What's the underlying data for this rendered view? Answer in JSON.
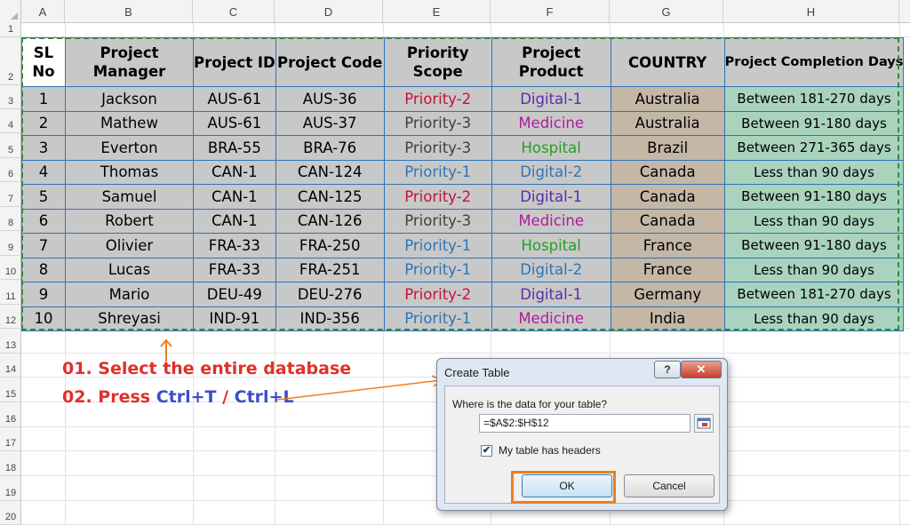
{
  "columns": [
    "A",
    "B",
    "C",
    "D",
    "E",
    "F",
    "G",
    "H"
  ],
  "rows": [
    "1",
    "2",
    "3",
    "4",
    "5",
    "6",
    "7",
    "8",
    "9",
    "10",
    "11",
    "12",
    "13",
    "14",
    "15",
    "16",
    "17",
    "18",
    "19",
    "20"
  ],
  "table": {
    "headers": {
      "sl": "SL No",
      "manager": "Project Manager",
      "id": "Project ID",
      "code": "Project Code",
      "priority": "Priority Scope",
      "product": "Project Product",
      "country": "COUNTRY",
      "days": "Project Completion Days"
    },
    "rows": [
      {
        "sl": "1",
        "manager": "Jackson",
        "id": "AUS-61",
        "code": "AUS-36",
        "priority": "Priority-2",
        "product": "Digital-1",
        "country": "Australia",
        "days": "Between 181-270 days"
      },
      {
        "sl": "2",
        "manager": "Mathew",
        "id": "AUS-61",
        "code": "AUS-37",
        "priority": "Priority-3",
        "product": "Medicine",
        "country": "Australia",
        "days": "Between 91-180 days"
      },
      {
        "sl": "3",
        "manager": "Everton",
        "id": "BRA-55",
        "code": "BRA-76",
        "priority": "Priority-3",
        "product": "Hospital",
        "country": "Brazil",
        "days": "Between 271-365 days"
      },
      {
        "sl": "4",
        "manager": "Thomas",
        "id": "CAN-1",
        "code": "CAN-124",
        "priority": "Priority-1",
        "product": "Digital-2",
        "country": "Canada",
        "days": "Less than 90 days"
      },
      {
        "sl": "5",
        "manager": "Samuel",
        "id": "CAN-1",
        "code": "CAN-125",
        "priority": "Priority-2",
        "product": "Digital-1",
        "country": "Canada",
        "days": "Between 91-180 days"
      },
      {
        "sl": "6",
        "manager": "Robert",
        "id": "CAN-1",
        "code": "CAN-126",
        "priority": "Priority-3",
        "product": "Medicine",
        "country": "Canada",
        "days": "Less than 90 days"
      },
      {
        "sl": "7",
        "manager": "Olivier",
        "id": "FRA-33",
        "code": "FRA-250",
        "priority": "Priority-1",
        "product": "Hospital",
        "country": "France",
        "days": "Between 91-180 days"
      },
      {
        "sl": "8",
        "manager": "Lucas",
        "id": "FRA-33",
        "code": "FRA-251",
        "priority": "Priority-1",
        "product": "Digital-2",
        "country": "France",
        "days": "Less than 90 days"
      },
      {
        "sl": "9",
        "manager": "Mario",
        "id": "DEU-49",
        "code": "DEU-276",
        "priority": "Priority-2",
        "product": "Digital-1",
        "country": "Germany",
        "days": "Between 181-270 days"
      },
      {
        "sl": "10",
        "manager": "Shreyasi",
        "id": "IND-91",
        "code": "IND-356",
        "priority": "Priority-1",
        "product": "Medicine",
        "country": "India",
        "days": "Less than 90 days"
      }
    ]
  },
  "colors": {
    "priority": {
      "Priority-1": "#2e75b6",
      "Priority-2": "#c0143c",
      "Priority-3": "#404040"
    },
    "product": {
      "Digital-1": "#5b2ca8",
      "Digital-2": "#2e75b6",
      "Medicine": "#b01aa0",
      "Hospital": "#22a022"
    },
    "annotation_red": "#e0302a",
    "annotation_blue": "#3b4fc4",
    "highlight_orange": "#f07d1e",
    "marquee_green": "#2e8b3d"
  },
  "annotations": {
    "step1": "01. Select the entire database",
    "step2_prefix": "02. Press ",
    "step2_key1": "Ctrl+T",
    "step2_sep": " / ",
    "step2_key2": "Ctrl+L"
  },
  "dialog": {
    "title": "Create Table",
    "help_label": "?",
    "close_label": "✕",
    "question": "Where is the data for your table?",
    "range_value": "=$A$2:$H$12",
    "headers_checked": true,
    "headers_label": "My table has headers",
    "ok_label": "OK",
    "cancel_label": "Cancel",
    "range_icon": "collapse-dialog-icon"
  }
}
